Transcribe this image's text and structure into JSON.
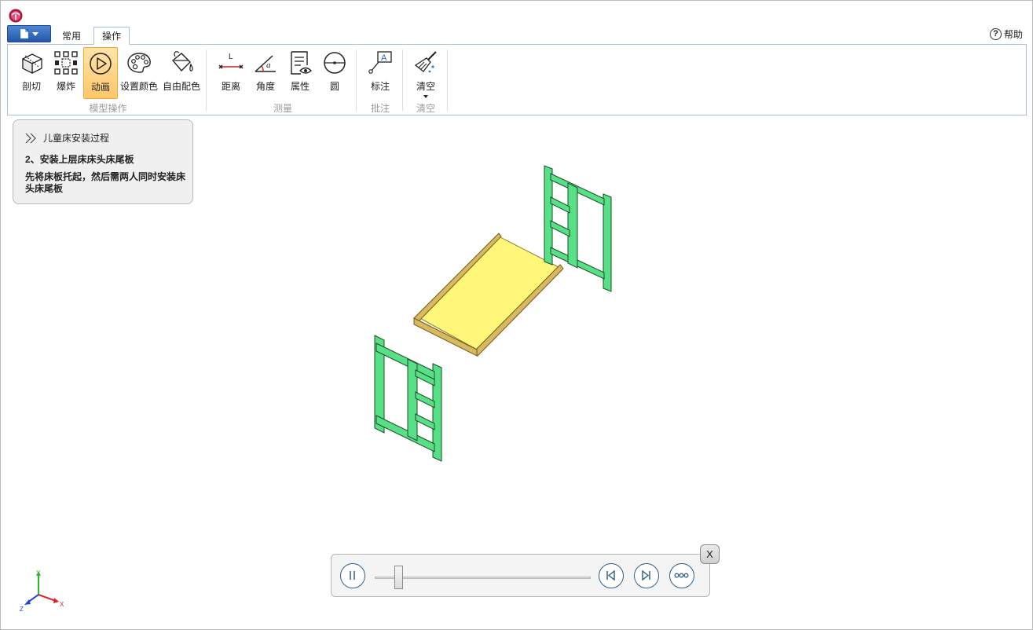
{
  "app": {
    "logo_icon": "app-logo-icon",
    "accent": "#2457a8"
  },
  "menu": {
    "file_icon": "document-icon"
  },
  "tabs": [
    {
      "label": "常用"
    },
    {
      "label": "操作"
    }
  ],
  "help": {
    "label": "帮助",
    "icon": "help-icon"
  },
  "ribbon": {
    "groups": [
      {
        "label": "模型操作"
      },
      {
        "label": "测量"
      },
      {
        "label": "批注"
      },
      {
        "label": "清空"
      }
    ],
    "buttons": [
      {
        "label": "剖切",
        "icon": "section-cube-icon"
      },
      {
        "label": "爆炸",
        "icon": "explode-icon"
      },
      {
        "label": "动画",
        "icon": "play-animation-icon",
        "active": true
      },
      {
        "label": "设置颜色",
        "icon": "palette-icon"
      },
      {
        "label": "自由配色",
        "icon": "paint-bucket-icon"
      },
      {
        "label": "距离",
        "icon": "distance-icon"
      },
      {
        "label": "角度",
        "icon": "angle-icon"
      },
      {
        "label": "属性",
        "icon": "properties-icon"
      },
      {
        "label": "圆",
        "icon": "circle-icon"
      },
      {
        "label": "标注",
        "icon": "annotate-icon"
      },
      {
        "label": "清空",
        "icon": "broom-icon"
      }
    ],
    "active_color": "#ffc76a"
  },
  "info": {
    "title": "儿童床安装过程",
    "step": "2、安装上层床床头床尾板",
    "description": "先将床板托起，然后需两人同时安装床头床尾板"
  },
  "model": {
    "frame_color": "#57e085",
    "board_color": "#fff67a",
    "rail_color": "#d8b960"
  },
  "axes": {
    "x_label": "X",
    "y_label": "Y",
    "z_label": "Z"
  },
  "player": {
    "progress": 0.11,
    "close_label": "X",
    "pause_icon": "pause-icon",
    "prev_icon": "step-back-icon",
    "next_icon": "step-forward-icon",
    "more_icon": "more-icon"
  }
}
